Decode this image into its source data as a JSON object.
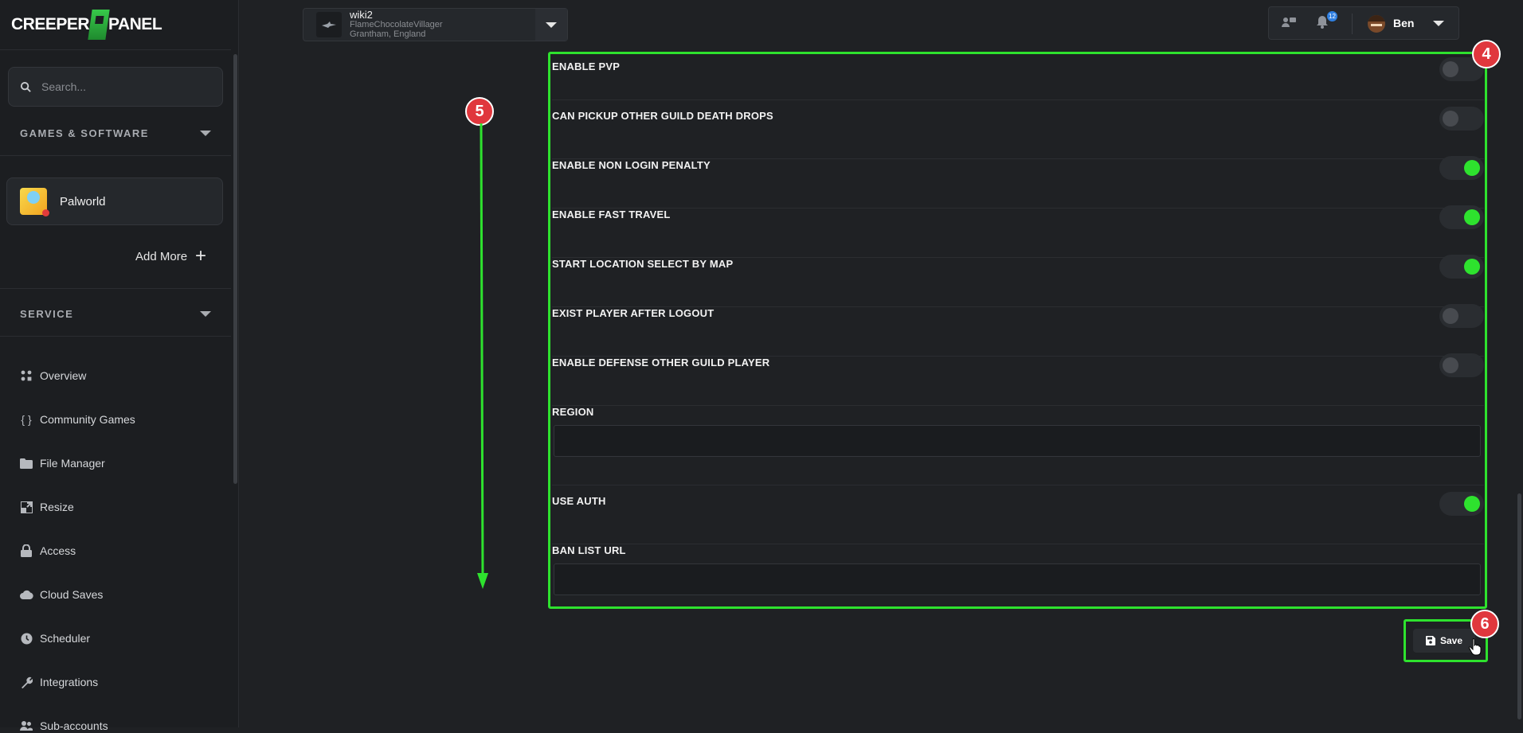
{
  "brand": {
    "logo_left": "CREEPER",
    "logo_right": "PANEL"
  },
  "sidebar": {
    "search_placeholder": "Search...",
    "games_section": "GAMES & SOFTWARE",
    "game": {
      "name": "Palworld",
      "icon": "palworld-icon"
    },
    "add_more": "Add More",
    "service_section": "SERVICE",
    "nav": [
      {
        "label": "Overview",
        "icon": "grid-icon"
      },
      {
        "label": "Community Games",
        "icon": "braces-icon"
      },
      {
        "label": "File Manager",
        "icon": "folder-icon"
      },
      {
        "label": "Resize",
        "icon": "resize-icon"
      },
      {
        "label": "Access",
        "icon": "lock-icon"
      },
      {
        "label": "Cloud Saves",
        "icon": "cloud-icon"
      },
      {
        "label": "Scheduler",
        "icon": "clock-icon"
      },
      {
        "label": "Integrations",
        "icon": "wrench-icon"
      },
      {
        "label": "Sub-accounts",
        "icon": "users-icon"
      }
    ]
  },
  "topbar": {
    "server": {
      "name": "wiki2",
      "line1": "FlameChocolateVillager",
      "line2": "Grantham, England"
    },
    "notifications_count": "12",
    "user_name": "Ben"
  },
  "settings": {
    "rows": [
      {
        "label": "ENABLE PVP",
        "type": "toggle",
        "on": false
      },
      {
        "label": "CAN PICKUP OTHER GUILD DEATH DROPS",
        "type": "toggle",
        "on": false
      },
      {
        "label": "ENABLE NON LOGIN PENALTY",
        "type": "toggle",
        "on": true
      },
      {
        "label": "ENABLE FAST TRAVEL",
        "type": "toggle",
        "on": true
      },
      {
        "label": "START LOCATION SELECT BY MAP",
        "type": "toggle",
        "on": true
      },
      {
        "label": "EXIST PLAYER AFTER LOGOUT",
        "type": "toggle",
        "on": false
      },
      {
        "label": "ENABLE DEFENSE OTHER GUILD PLAYER",
        "type": "toggle",
        "on": false
      },
      {
        "label": "REGION",
        "type": "text",
        "value": ""
      },
      {
        "label": "USE AUTH",
        "type": "toggle",
        "on": true
      },
      {
        "label": "BAN LIST URL",
        "type": "text",
        "value": ""
      }
    ],
    "save_label": "Save"
  },
  "annotations": {
    "marker_4": "4",
    "marker_5": "5",
    "marker_6": "6"
  },
  "colors": {
    "accent": "#2ee22e",
    "marker": "#e0373d",
    "bg": "#1f2124",
    "sidebar_bg": "#1c1e21"
  }
}
